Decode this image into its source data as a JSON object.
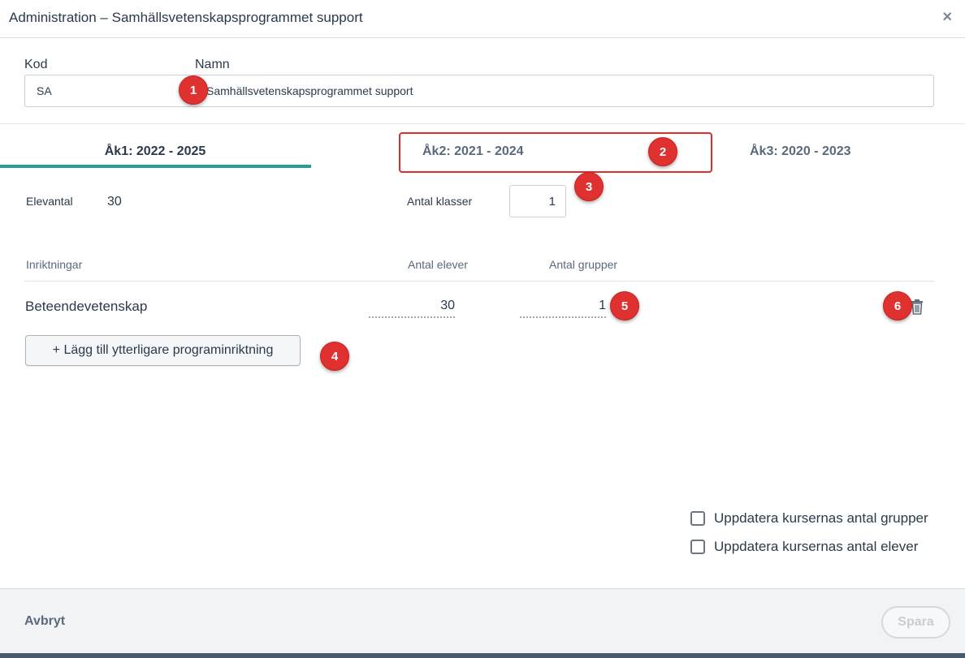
{
  "dialog": {
    "title": "Administration – Samhällsvetenskapsprogrammet support",
    "close_symbol": "×"
  },
  "fields": {
    "code_label": "Kod",
    "code_value": "SA",
    "name_label": "Namn",
    "name_value": "Samhällsvetenskapsprogrammet support"
  },
  "tabs": [
    {
      "label": "Åk1: 2022 - 2025",
      "active": true
    },
    {
      "label": "Åk2: 2021 - 2024",
      "active": false
    },
    {
      "label": "Åk3: 2020 - 2023",
      "active": false
    }
  ],
  "stats": {
    "students_label": "Elevantal",
    "students_value": "30",
    "classes_label": "Antal klasser",
    "classes_value": "1"
  },
  "table": {
    "columns": [
      "Inriktningar",
      "Antal elever",
      "Antal grupper"
    ],
    "rows": [
      {
        "name": "Beteendevetenskap",
        "students": "30",
        "groups": "1"
      }
    ]
  },
  "add_button_label": "+ Lägg till ytterligare programinriktning",
  "checkboxes": [
    {
      "label": "Uppdatera kursernas antal grupper",
      "checked": false
    },
    {
      "label": "Uppdatera kursernas antal elever",
      "checked": false
    }
  ],
  "footer": {
    "cancel_label": "Avbryt",
    "save_label": "Spara"
  },
  "annotations": [
    "1",
    "2",
    "3",
    "4",
    "5",
    "6"
  ],
  "colors": {
    "accent": "#2a9d9b",
    "annotation_red": "#e03131",
    "text": "#2b3a4a"
  }
}
